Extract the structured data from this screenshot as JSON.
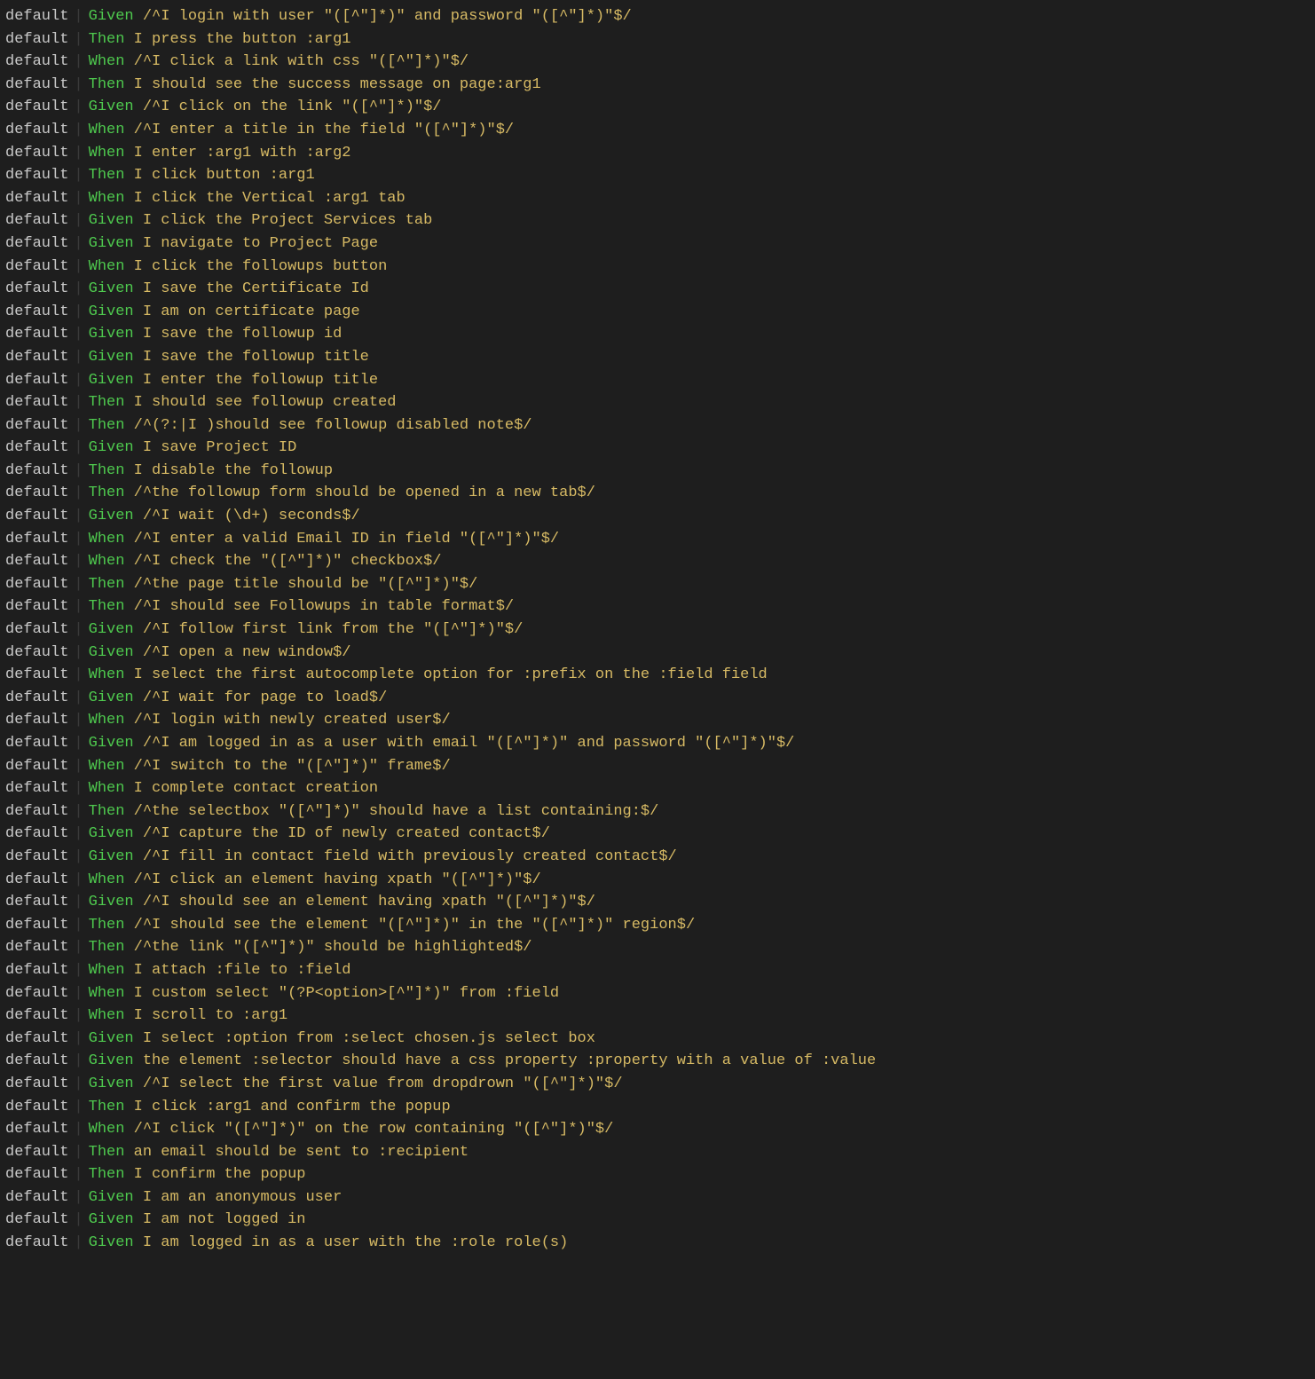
{
  "separator": "|",
  "rows": [
    {
      "suite": "default",
      "keyword": "Given",
      "text": "/^I login with user \"([^\"]*)\" and password \"([^\"]*)\"$/"
    },
    {
      "suite": "default",
      "keyword": "Then",
      "text": "I press the button :arg1"
    },
    {
      "suite": "default",
      "keyword": "When",
      "text": "/^I click a link with css \"([^\"]*)\"$/"
    },
    {
      "suite": "default",
      "keyword": "Then",
      "text": "I should see the success message on page:arg1"
    },
    {
      "suite": "default",
      "keyword": "Given",
      "text": "/^I click on the link \"([^\"]*)\"$/"
    },
    {
      "suite": "default",
      "keyword": "When",
      "text": "/^I enter a title in the field \"([^\"]*)\"$/"
    },
    {
      "suite": "default",
      "keyword": "When",
      "text": "I enter :arg1 with :arg2"
    },
    {
      "suite": "default",
      "keyword": "Then",
      "text": "I click button :arg1"
    },
    {
      "suite": "default",
      "keyword": "When",
      "text": "I click the Vertical :arg1 tab"
    },
    {
      "suite": "default",
      "keyword": "Given",
      "text": "I click the Project Services tab"
    },
    {
      "suite": "default",
      "keyword": "Given",
      "text": "I navigate to Project Page"
    },
    {
      "suite": "default",
      "keyword": "When",
      "text": "I click the followups button"
    },
    {
      "suite": "default",
      "keyword": "Given",
      "text": "I save the Certificate Id"
    },
    {
      "suite": "default",
      "keyword": "Given",
      "text": "I am on certificate page"
    },
    {
      "suite": "default",
      "keyword": "Given",
      "text": "I save the followup id"
    },
    {
      "suite": "default",
      "keyword": "Given",
      "text": "I save the followup title"
    },
    {
      "suite": "default",
      "keyword": "Given",
      "text": "I enter the followup title"
    },
    {
      "suite": "default",
      "keyword": "Then",
      "text": "I should see followup created"
    },
    {
      "suite": "default",
      "keyword": "Then",
      "text": "/^(?:|I )should see followup disabled note$/"
    },
    {
      "suite": "default",
      "keyword": "Given",
      "text": "I save Project ID"
    },
    {
      "suite": "default",
      "keyword": "Then",
      "text": "I disable the followup"
    },
    {
      "suite": "default",
      "keyword": "Then",
      "text": "/^the followup form should be opened in a new tab$/"
    },
    {
      "suite": "default",
      "keyword": "Given",
      "text": "/^I wait (\\d+) seconds$/"
    },
    {
      "suite": "default",
      "keyword": "When",
      "text": "/^I enter a valid Email ID in field \"([^\"]*)\"$/"
    },
    {
      "suite": "default",
      "keyword": "When",
      "text": "/^I check the \"([^\"]*)\" checkbox$/"
    },
    {
      "suite": "default",
      "keyword": "Then",
      "text": "/^the page title should be \"([^\"]*)\"$/"
    },
    {
      "suite": "default",
      "keyword": "Then",
      "text": "/^I should see Followups in table format$/"
    },
    {
      "suite": "default",
      "keyword": "Given",
      "text": "/^I follow first link from the \"([^\"]*)\"$/"
    },
    {
      "suite": "default",
      "keyword": "Given",
      "text": "/^I open a new window$/"
    },
    {
      "suite": "default",
      "keyword": "When",
      "text": "I select the first autocomplete option for :prefix on the :field field"
    },
    {
      "suite": "default",
      "keyword": "Given",
      "text": "/^I wait for page to load$/"
    },
    {
      "suite": "default",
      "keyword": "When",
      "text": "/^I login with newly created user$/"
    },
    {
      "suite": "default",
      "keyword": "Given",
      "text": "/^I am logged in as a user with email \"([^\"]*)\" and password \"([^\"]*)\"$/"
    },
    {
      "suite": "default",
      "keyword": "When",
      "text": "/^I switch to the \"([^\"]*)\" frame$/"
    },
    {
      "suite": "default",
      "keyword": "When",
      "text": "I complete contact creation"
    },
    {
      "suite": "default",
      "keyword": "Then",
      "text": "/^the selectbox \"([^\"]*)\" should have a list containing:$/"
    },
    {
      "suite": "default",
      "keyword": "Given",
      "text": "/^I capture the ID of newly created contact$/"
    },
    {
      "suite": "default",
      "keyword": "Given",
      "text": "/^I fill in contact field with previously created contact$/"
    },
    {
      "suite": "default",
      "keyword": "When",
      "text": "/^I click an element having xpath \"([^\"]*)\"$/"
    },
    {
      "suite": "default",
      "keyword": "Given",
      "text": "/^I should see an element having xpath \"([^\"]*)\"$/"
    },
    {
      "suite": "default",
      "keyword": "Then",
      "text": "/^I should see the element \"([^\"]*)\" in the \"([^\"]*)\" region$/"
    },
    {
      "suite": "default",
      "keyword": "Then",
      "text": "/^the link \"([^\"]*)\" should be highlighted$/"
    },
    {
      "suite": "default",
      "keyword": "When",
      "text": "I attach :file to :field"
    },
    {
      "suite": "default",
      "keyword": "When",
      "text": "I custom select \"(?P<option>[^\"]*)\" from :field"
    },
    {
      "suite": "default",
      "keyword": "When",
      "text": "I scroll to :arg1"
    },
    {
      "suite": "default",
      "keyword": "Given",
      "text": "I select :option from :select chosen.js select box"
    },
    {
      "suite": "default",
      "keyword": "Given",
      "text": "the element :selector should have a css property :property with a value of :value"
    },
    {
      "suite": "default",
      "keyword": "Given",
      "text": "/^I select the first value from dropdrown \"([^\"]*)\"$/"
    },
    {
      "suite": "default",
      "keyword": "Then",
      "text": "I click :arg1 and confirm the popup"
    },
    {
      "suite": "default",
      "keyword": "When",
      "text": "/^I click \"([^\"]*)\" on the row containing \"([^\"]*)\"$/"
    },
    {
      "suite": "default",
      "keyword": "Then",
      "text": "an email should be sent to :recipient"
    },
    {
      "suite": "default",
      "keyword": "Then",
      "text": "I confirm the popup"
    },
    {
      "suite": "default",
      "keyword": "Given",
      "text": "I am an anonymous user"
    },
    {
      "suite": "default",
      "keyword": "Given",
      "text": "I am not logged in"
    },
    {
      "suite": "default",
      "keyword": "Given",
      "text": "I am logged in as a user with the :role role(s)"
    }
  ]
}
